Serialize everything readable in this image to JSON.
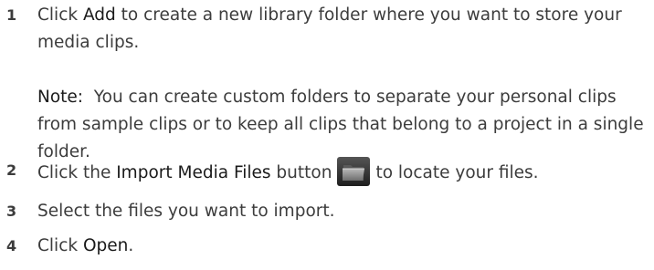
{
  "steps": [
    {
      "number": "1",
      "pre": "Click ",
      "term": "Add",
      "post": " to create a new library folder where you want to store your media clips."
    },
    {
      "number": "2",
      "pre": "Click the ",
      "term": "Import Media Files",
      "post_before_icon": " button",
      "icon": "folder-icon",
      "post": "to locate your files."
    },
    {
      "number": "3",
      "text": "Select the files you want to import."
    },
    {
      "number": "4",
      "pre": "Click ",
      "term": "Open",
      "post": "."
    }
  ],
  "note": {
    "label": "Note:",
    "text": "  You can create custom folders to separate your personal clips from sample clips or to keep all clips that belong to a project in a single folder."
  },
  "colors": {
    "text": "#3c3c3c",
    "emphasis": "#1a1a1a",
    "folder_icon_dark": "#2a2a2a",
    "folder_icon_mid": "#8a8a8a"
  }
}
